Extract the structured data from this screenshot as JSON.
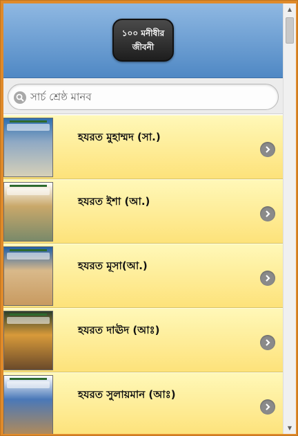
{
  "header": {
    "title": "১০০ মনীষীর জীবনী"
  },
  "search": {
    "placeholder": "সার্চ শ্রেষ্ঠ মানব"
  },
  "list": {
    "items": [
      {
        "title": "হযরত মুহাম্মদ (সা.)",
        "thumb_colors": [
          "#2e6fb0",
          "#8fa9c4",
          "#d6d0b8"
        ]
      },
      {
        "title": "হযরত ইশা (আ.)",
        "thumb_colors": [
          "#ffffff",
          "#c9a86a",
          "#7a8a6a"
        ]
      },
      {
        "title": "হযরত মূসা(আ.)",
        "thumb_colors": [
          "#1f5fa8",
          "#d9b98a",
          "#c89a60"
        ]
      },
      {
        "title": "হযরত দাঊদ (আঃ)",
        "thumb_colors": [
          "#2a3f2a",
          "#d89a3a",
          "#6a4a2a"
        ]
      },
      {
        "title": "হযরত সুলায়মান (আঃ)",
        "thumb_colors": [
          "#ffffff",
          "#4a78b8",
          "#b08a5a"
        ]
      }
    ]
  },
  "icons": {
    "search": "search-icon",
    "chevron": "chevron-right-icon"
  },
  "colors": {
    "header_top": "#8fb8e2",
    "header_bottom": "#4f88c4",
    "item_top": "#fff8b8",
    "item_bottom": "#fde27a",
    "window_border": "#e08a2a"
  }
}
